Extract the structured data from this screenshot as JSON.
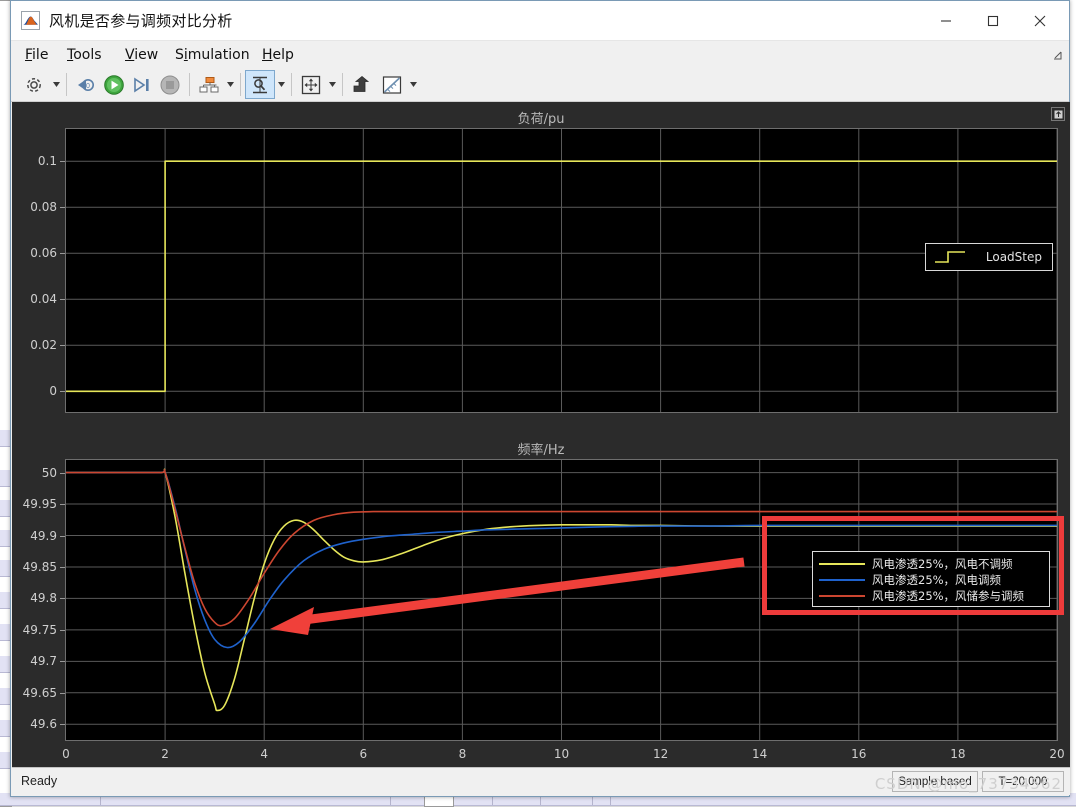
{
  "window": {
    "title": "风机是否参与调频对比分析",
    "app_icon": "matlab-scope-icon",
    "controls": {
      "minimize": "minimize-icon",
      "maximize": "maximize-icon",
      "close": "close-icon"
    }
  },
  "menubar": {
    "items": [
      {
        "id": "file",
        "label": "File",
        "mnemonic": "F"
      },
      {
        "id": "tools",
        "label": "Tools",
        "mnemonic": "T"
      },
      {
        "id": "view",
        "label": "View",
        "mnemonic": "V"
      },
      {
        "id": "simulation",
        "label": "Simulation",
        "mnemonic": "S"
      },
      {
        "id": "help",
        "label": "Help",
        "mnemonic": "H"
      }
    ],
    "expander": "expand-menubar-icon"
  },
  "toolbar": {
    "items": [
      {
        "id": "configuration",
        "icon": "gear-icon",
        "label": "Configuration Properties",
        "dropdown": true,
        "selected": false
      },
      {
        "id": "rewind",
        "icon": "rewind-icon",
        "label": "Step Back",
        "dropdown": false,
        "selected": false
      },
      {
        "id": "run",
        "icon": "play-icon",
        "label": "Run",
        "dropdown": false,
        "selected": false
      },
      {
        "id": "step-forward",
        "icon": "step-forward-icon",
        "label": "Step Forward",
        "dropdown": false,
        "selected": false
      },
      {
        "id": "stop",
        "icon": "stop-icon",
        "label": "Stop",
        "dropdown": false,
        "selected": false
      },
      {
        "id": "layout",
        "icon": "block-layout-icon",
        "label": "Signal Selector",
        "dropdown": true,
        "selected": false
      },
      {
        "id": "zoom",
        "icon": "zoom-in-icon",
        "label": "Zoom In",
        "dropdown": true,
        "selected": true
      },
      {
        "id": "fit-to-view",
        "icon": "fit-to-view-icon",
        "label": "Scale Axes Limits",
        "dropdown": true,
        "selected": false
      },
      {
        "id": "export",
        "icon": "export-up-icon",
        "label": "Share / Export",
        "dropdown": false,
        "selected": false
      },
      {
        "id": "measurements",
        "icon": "measurement-ruler-icon",
        "label": "Measurements",
        "dropdown": true,
        "selected": false
      }
    ]
  },
  "scope": {
    "expand_icon": "maximize-plot-icon",
    "background": "#000000",
    "grid_color": "#585858"
  },
  "annotation": {
    "rectangle_color": "#ee3b3b",
    "arrow_color": "#f0403a",
    "arrow_label": "red-arrow-pointing-to-nadir"
  },
  "statusbar": {
    "ready": "Ready",
    "mode": "Sample based",
    "time": "T=20.000",
    "watermark": "CSDN @mo_73734562"
  },
  "chart_data": [
    {
      "type": "line",
      "id": "load-plot",
      "title": "负荷/pu",
      "xlabel": "",
      "ylabel": "",
      "xlim": [
        0,
        20
      ],
      "ylim": [
        -0.009,
        0.114
      ],
      "xticks": [
        0,
        2,
        4,
        6,
        8,
        10,
        12,
        14,
        16,
        18,
        20
      ],
      "yticks": [
        0,
        0.02,
        0.04,
        0.06,
        0.08,
        0.1
      ],
      "ytick_labels": [
        "0",
        "0.02",
        "0.04",
        "0.06",
        "0.08",
        "0.1"
      ],
      "grid": true,
      "legend_position": "top-right",
      "series": [
        {
          "name": "LoadStep",
          "color": "#e6e65a",
          "x": [
            0,
            2,
            2,
            20
          ],
          "y": [
            0,
            0,
            0.1,
            0.1
          ]
        }
      ]
    },
    {
      "type": "line",
      "id": "frequency-plot",
      "title": "频率/Hz",
      "xlabel": "",
      "ylabel": "",
      "xlim": [
        0,
        20
      ],
      "ylim": [
        49.575,
        50.02
      ],
      "xticks": [
        0,
        2,
        4,
        6,
        8,
        10,
        12,
        14,
        16,
        18,
        20
      ],
      "yticks": [
        49.6,
        49.65,
        49.7,
        49.75,
        49.8,
        49.85,
        49.9,
        49.95,
        50
      ],
      "ytick_labels": [
        "49.6",
        "49.65",
        "49.7",
        "49.75",
        "49.8",
        "49.85",
        "49.9",
        "49.95",
        "50"
      ],
      "grid": true,
      "legend_position": "inside-right",
      "series": [
        {
          "name": "风电渗透25%，风电不调频",
          "color": "#e6e65a",
          "nadir": 49.622,
          "nadir_time": 3.05,
          "steady_state": 49.915,
          "x": [
            0,
            1.0,
            1.9,
            2.0,
            2.2,
            2.4,
            2.6,
            2.8,
            3.0,
            3.05,
            3.2,
            3.4,
            3.6,
            3.8,
            4.0,
            4.2,
            4.4,
            4.6,
            4.8,
            5.0,
            5.2,
            5.4,
            5.6,
            5.8,
            6.0,
            6.4,
            6.8,
            7.2,
            7.6,
            8.0,
            8.5,
            9.0,
            9.5,
            10.0,
            10.5,
            11.0,
            11.5,
            12.0,
            13.0,
            14.0,
            15.0,
            16.0,
            18.0,
            20.0
          ],
          "y": [
            50.0,
            50.0,
            50.0,
            50.0,
            49.93,
            49.84,
            49.755,
            49.682,
            49.632,
            49.622,
            49.63,
            49.672,
            49.735,
            49.8,
            49.855,
            49.893,
            49.915,
            49.924,
            49.921,
            49.909,
            49.893,
            49.878,
            49.866,
            49.86,
            49.858,
            49.862,
            49.872,
            49.884,
            49.895,
            49.903,
            49.91,
            49.914,
            49.916,
            49.917,
            49.917,
            49.917,
            49.916,
            49.916,
            49.915,
            49.915,
            49.915,
            49.915,
            49.915,
            49.915
          ]
        },
        {
          "name": "风电渗透25%，风电调频",
          "color": "#1f62cc",
          "nadir": 49.722,
          "nadir_time": 3.25,
          "steady_state": 49.916,
          "x": [
            0,
            1.0,
            1.9,
            2.0,
            2.2,
            2.4,
            2.6,
            2.8,
            3.0,
            3.25,
            3.5,
            3.8,
            4.1,
            4.4,
            4.8,
            5.2,
            5.6,
            6.0,
            6.5,
            7.0,
            7.5,
            8.0,
            8.5,
            9.0,
            9.5,
            10.0,
            11.0,
            12.0,
            13.0,
            14.0,
            16.0,
            18.0,
            20.0
          ],
          "y": [
            50.0,
            50.0,
            50.0,
            50.0,
            49.945,
            49.878,
            49.814,
            49.766,
            49.735,
            49.722,
            49.731,
            49.76,
            49.797,
            49.829,
            49.86,
            49.878,
            49.888,
            49.894,
            49.899,
            49.902,
            49.905,
            49.907,
            49.909,
            49.91,
            49.911,
            49.912,
            49.914,
            49.915,
            49.915,
            49.916,
            49.916,
            49.916,
            49.916
          ]
        },
        {
          "name": "风电渗透25%，风储参与调频",
          "color": "#cc4630",
          "nadir": 49.757,
          "nadir_time": 3.15,
          "steady_state": 49.938,
          "x": [
            0,
            1.0,
            1.9,
            2.0,
            2.2,
            2.4,
            2.6,
            2.8,
            3.0,
            3.15,
            3.4,
            3.7,
            4.0,
            4.3,
            4.6,
            5.0,
            5.4,
            5.8,
            6.2,
            6.6,
            7.0,
            7.5,
            8.0,
            9.0,
            10.0,
            12.0,
            14.0,
            16.0,
            18.0,
            20.0
          ],
          "y": [
            50.0,
            50.0,
            50.0,
            50.0,
            49.942,
            49.88,
            49.824,
            49.784,
            49.762,
            49.757,
            49.768,
            49.8,
            49.84,
            49.876,
            49.903,
            49.924,
            49.933,
            49.937,
            49.938,
            49.938,
            49.938,
            49.938,
            49.938,
            49.938,
            49.938,
            49.938,
            49.938,
            49.938,
            49.938,
            49.938
          ]
        }
      ]
    }
  ]
}
